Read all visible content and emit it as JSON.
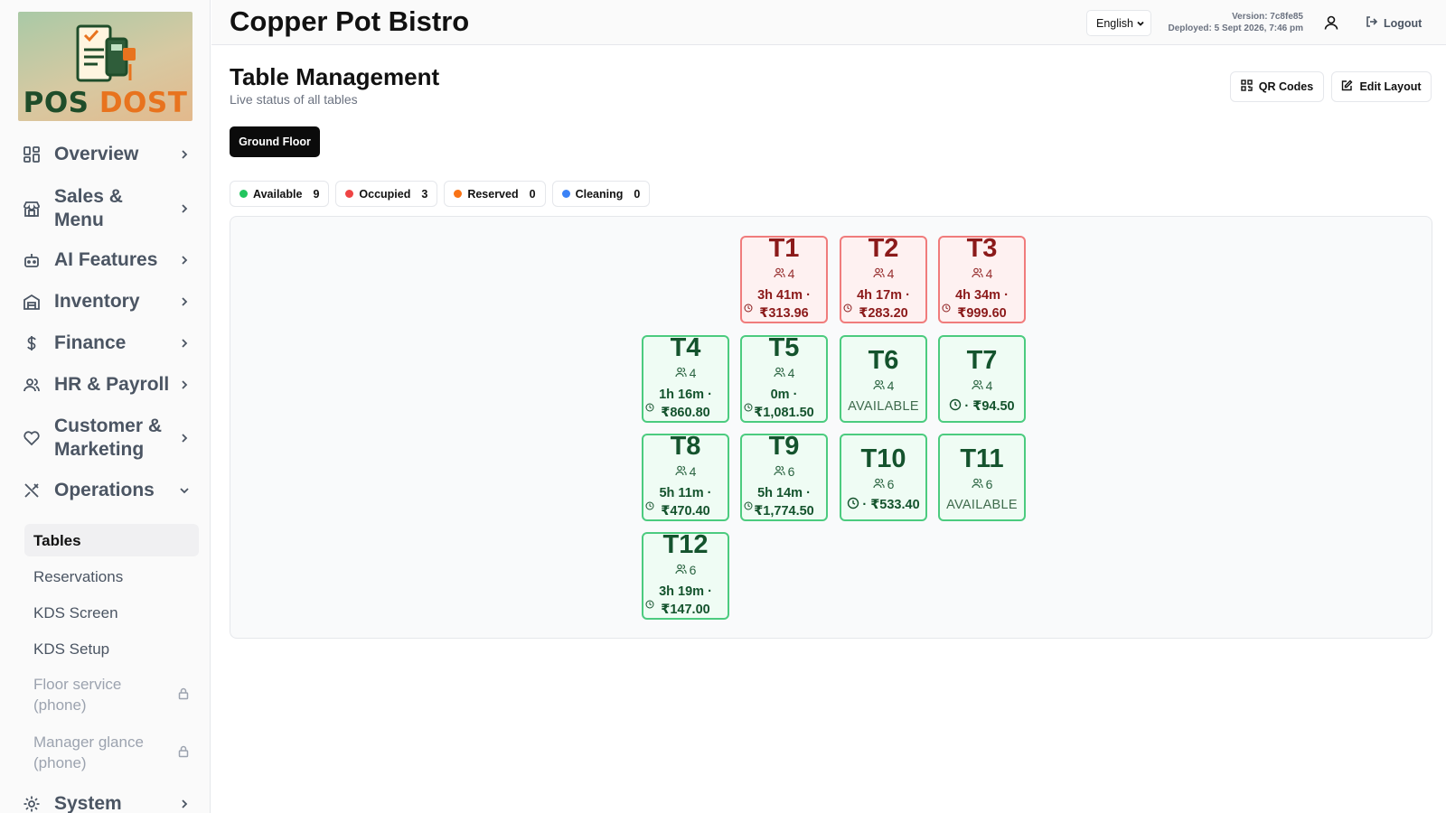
{
  "app": {
    "restaurant_name": "Copper Pot Bistro",
    "logo_text_1": "POS",
    "logo_text_2": "DOST"
  },
  "header": {
    "language": "English",
    "version_label": "Version: 7c8fe85",
    "deployed_label": "Deployed: 5 Sept 2026, 7:46 pm",
    "logout_label": "Logout"
  },
  "sidebar": {
    "items": [
      {
        "label": "Overview"
      },
      {
        "label": "Sales &\nMenu"
      },
      {
        "label": "AI Features"
      },
      {
        "label": "Inventory"
      },
      {
        "label": "Finance"
      },
      {
        "label": "HR & Payroll"
      },
      {
        "label": "Customer &\nMarketing"
      },
      {
        "label": "Operations"
      },
      {
        "label": "System"
      }
    ],
    "sub_items": [
      {
        "label": "Tables"
      },
      {
        "label": "Reservations"
      },
      {
        "label": "KDS Screen"
      },
      {
        "label": "KDS Setup"
      },
      {
        "label": "Floor service\n(phone)"
      },
      {
        "label": "Manager glance\n(phone)"
      }
    ]
  },
  "main": {
    "title": "Table Management",
    "subtitle": "Live status of all tables",
    "qr_button": "QR Codes",
    "edit_button": "Edit Layout",
    "floor_tab": "Ground Floor",
    "legend": [
      {
        "label": "Available",
        "count": "9",
        "color": "#22c55e"
      },
      {
        "label": "Occupied",
        "count": "3",
        "color": "#ef4444"
      },
      {
        "label": "Reserved",
        "count": "0",
        "color": "#f97316"
      },
      {
        "label": "Cleaning",
        "count": "0",
        "color": "#3b82f6"
      }
    ],
    "tables": [
      {
        "name": "T1",
        "seats": "4",
        "time": "3h 41m ·",
        "amount": "₹313.96",
        "status": "occupied"
      },
      {
        "name": "T2",
        "seats": "4",
        "time": "4h 17m ·",
        "amount": "₹283.20",
        "status": "occupied"
      },
      {
        "name": "T3",
        "seats": "4",
        "time": "4h 34m ·",
        "amount": "₹999.60",
        "status": "occupied"
      },
      {
        "name": "T4",
        "seats": "4",
        "time": "1h 16m ·",
        "amount": "₹860.80",
        "status": "available"
      },
      {
        "name": "T5",
        "seats": "4",
        "time": "0m ·",
        "amount": "₹1,081.50",
        "status": "available"
      },
      {
        "name": "T6",
        "seats": "4",
        "text": "AVAILABLE",
        "status": "available"
      },
      {
        "name": "T7",
        "seats": "4",
        "amount": "· ₹94.50",
        "status": "available"
      },
      {
        "name": "T8",
        "seats": "4",
        "time": "5h 11m ·",
        "amount": "₹470.40",
        "status": "available"
      },
      {
        "name": "T9",
        "seats": "6",
        "time": "5h 14m ·",
        "amount": "₹1,774.50",
        "status": "available"
      },
      {
        "name": "T10",
        "seats": "6",
        "amount": "· ₹533.40",
        "status": "available"
      },
      {
        "name": "T11",
        "seats": "6",
        "text": "AVAILABLE",
        "status": "available"
      },
      {
        "name": "T12",
        "seats": "6",
        "time": "3h 19m ·",
        "amount": "₹147.00",
        "status": "available"
      }
    ]
  }
}
